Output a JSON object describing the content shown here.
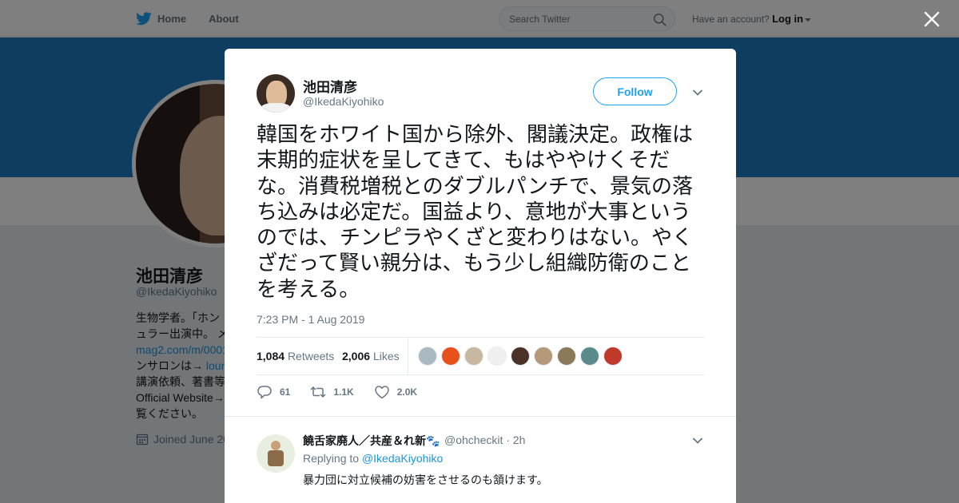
{
  "nav": {
    "home": "Home",
    "about": "About",
    "search_placeholder": "Search Twitter",
    "have_account": "Have an account?",
    "login": "Log in"
  },
  "profile": {
    "name": "池田清彦",
    "handle": "@IkedaKiyohiko",
    "bio_line1": "生物学者。「ホン",
    "bio_line2": "ュラー出演中。 メ",
    "bio_link1": "mag2.com/m/0001",
    "bio_line3": "ンサロンは→ ",
    "bio_link2": "loun",
    "bio_line4": "講演依頼、著書等",
    "bio_line5": "Official Website→",
    "bio_line6": "覧ください。",
    "joined": "Joined June 20"
  },
  "tweet": {
    "author_name": "池田清彦",
    "author_handle": "@IkedaKiyohiko",
    "follow_label": "Follow",
    "text": "韓国をホワイト国から除外、閣議決定。政権は末期的症状を呈してきて、もはややけくそだな。消費税増税とのダブルパンチで、景気の落ち込みは必定だ。国益より、意地が大事というのでは、チンピラやくざと変わりはない。やくざだって賢い親分は、もう少し組織防衛のことを考える。",
    "timestamp": "7:23 PM - 1 Aug 2019",
    "retweets_count": "1,084",
    "retweets_label": "Retweets",
    "likes_count": "2,006",
    "likes_label": "Likes",
    "reply_action": "61",
    "retweet_action": "1.1K",
    "like_action": "2.0K",
    "liker_colors": [
      "#aab8c2",
      "#e8501c",
      "#c8b8a0",
      "#f0f0f0",
      "#4a3228",
      "#b59a7a",
      "#8a7a5a",
      "#5a8a8a",
      "#c0392b"
    ]
  },
  "reply": {
    "name": "饒舌家廃人／共産＆れ新🐾",
    "handle": "@ohcheckit · 2h",
    "replying_to": "Replying to ",
    "replying_handle": "@IkedaKiyohiko",
    "text": "暴力団に対立候補の妨害をさせるのも頷けます。"
  }
}
